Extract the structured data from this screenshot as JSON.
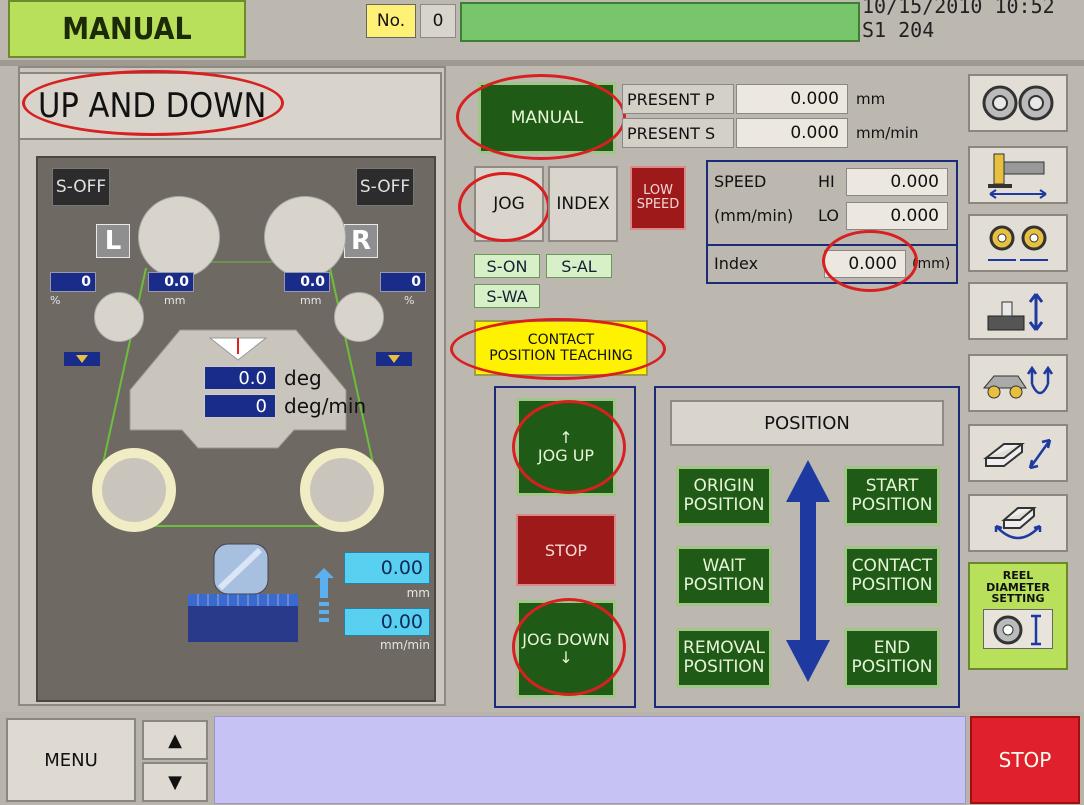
{
  "header": {
    "mode": "MANUAL",
    "no_label": "No.",
    "no_value": "0",
    "datetime": "10/15/2010  10:52 S1 204"
  },
  "left": {
    "section_title": "UP AND DOWN",
    "soff_left": "S-OFF",
    "soff_right": "S-OFF",
    "badge_left": "L",
    "badge_right": "R",
    "pct_left": "0",
    "pct_right": "0",
    "pct_unit": "%",
    "mm_left": "0.0",
    "mm_right": "0.0",
    "mm_unit": "mm",
    "deg_value": "0.0",
    "deg_unit": "deg",
    "degmin_value": "0",
    "degmin_unit": "deg/min",
    "pos_value": "0.00",
    "pos_unit": "mm",
    "speed_value": "0.00",
    "speed_unit": "mm/min"
  },
  "center": {
    "manual_button": "MANUAL",
    "present_p_label": "PRESENT P",
    "present_p_value": "0.000",
    "present_p_unit": "mm",
    "present_s_label": "PRESENT S",
    "present_s_value": "0.000",
    "present_s_unit": "mm/min",
    "jog_button": "JOG",
    "index_button": "INDEX",
    "low_speed_button": "LOW SPEED",
    "speed_label": "SPEED",
    "speed_unit_label": "(mm/min)",
    "hi_label": "HI",
    "hi_value": "0.000",
    "lo_label": "LO",
    "lo_value": "0.000",
    "index_label": "Index",
    "index_value": "0.000",
    "index_unit": "(mm)",
    "status_son": "S-ON",
    "status_sal": "S-AL",
    "status_swa": "S-WA",
    "contact_teach_line1": "CONTACT",
    "contact_teach_line2": "POSITION TEACHING",
    "jog_up_arrow": "↑",
    "jog_up": "JOG UP",
    "stop_button": "STOP",
    "jog_down": "JOG DOWN",
    "jog_down_arrow": "↓"
  },
  "position": {
    "title": "POSITION",
    "origin_1": "ORIGIN",
    "origin_2": "POSITION",
    "start_1": "START",
    "start_2": "POSITION",
    "wait_1": "WAIT",
    "wait_2": "POSITION",
    "contact_1": "CONTACT",
    "contact_2": "POSITION",
    "removal_1": "REMOVAL",
    "removal_2": "POSITION",
    "end_1": "END",
    "end_2": "POSITION"
  },
  "right_column": {
    "icons": [
      "double-reel-icon",
      "slide-width-icon",
      "reel-pair-width-icon",
      "lift-up-down-icon",
      "cart-up-down-icon",
      "block-diagonal-icon",
      "block-rotate-icon"
    ],
    "reel_line1": "REEL",
    "reel_line2": "DIAMETER",
    "reel_line3": "SETTING"
  },
  "footer": {
    "menu": "MENU",
    "up_arrow": "▲",
    "down_arrow": "▼",
    "stop": "STOP"
  },
  "colors": {
    "mode_green": "#b8e05a",
    "button_green": "#1f5a16",
    "stop_red": "#e0202c",
    "highlight_yellow": "#fff200",
    "panel_navy": "#1a2c8a",
    "annotation_red": "#d92020"
  }
}
